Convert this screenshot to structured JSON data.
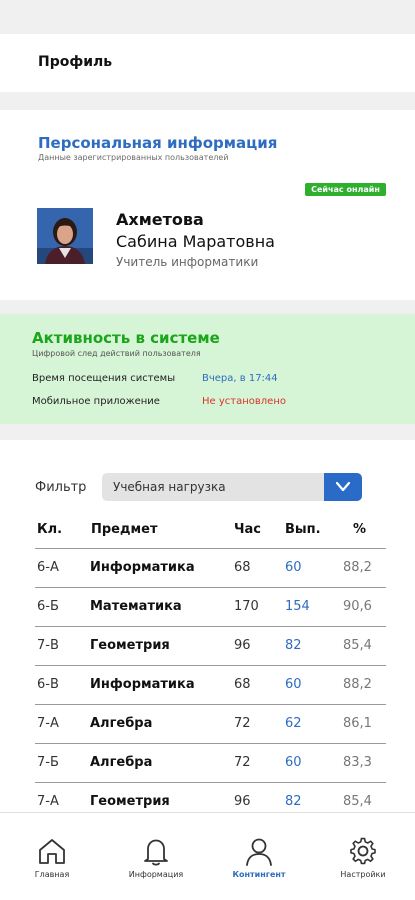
{
  "header": {
    "title": "Профиль"
  },
  "personal": {
    "title": "Персональная информация",
    "subtitle": "Данные зарегистрированных пользователей",
    "badge": "Сейчас онлайн",
    "surname": "Ахметова",
    "name": "Сабина Маратовна",
    "role": "Учитель информатики"
  },
  "activity": {
    "title": "Активность в системе",
    "subtitle": "Цифровой след действий пользователя",
    "visit_label": "Время посещения системы",
    "visit_value": "Вчера, в 17:44",
    "mobile_label": "Мобильное приложение",
    "mobile_value": "Не установлено"
  },
  "filter": {
    "label": "Фильтр",
    "value": "Учебная нагрузка"
  },
  "table": {
    "headers": [
      "Кл.",
      "Предмет",
      "Час",
      "Вып.",
      "%"
    ],
    "rows": [
      [
        "6-А",
        "Информатика",
        "68",
        "60",
        "88,2"
      ],
      [
        "6-Б",
        "Математика",
        "170",
        "154",
        "90,6"
      ],
      [
        "7-В",
        "Геометрия",
        "96",
        "82",
        "85,4"
      ],
      [
        "6-В",
        "Информатика",
        "68",
        "60",
        "88,2"
      ],
      [
        "7-А",
        "Алгебра",
        "72",
        "62",
        "86,1"
      ],
      [
        "7-Б",
        "Алгебра",
        "72",
        "60",
        "83,3"
      ],
      [
        "7-А",
        "Геометрия",
        "96",
        "82",
        "85,4"
      ]
    ]
  },
  "tabs": [
    {
      "label": "Главная",
      "icon": "home-icon"
    },
    {
      "label": "Информация",
      "icon": "bell-icon"
    },
    {
      "label": "Контингент",
      "icon": "person-icon",
      "active": true
    },
    {
      "label": "Настройки",
      "icon": "gear-icon"
    }
  ],
  "colors": {
    "accent": "#2d6cc0",
    "online": "#2eaf2e",
    "activity_bg": "#d6f5d6",
    "activity_title": "#1aa51a",
    "not_installed": "#d9342b"
  }
}
